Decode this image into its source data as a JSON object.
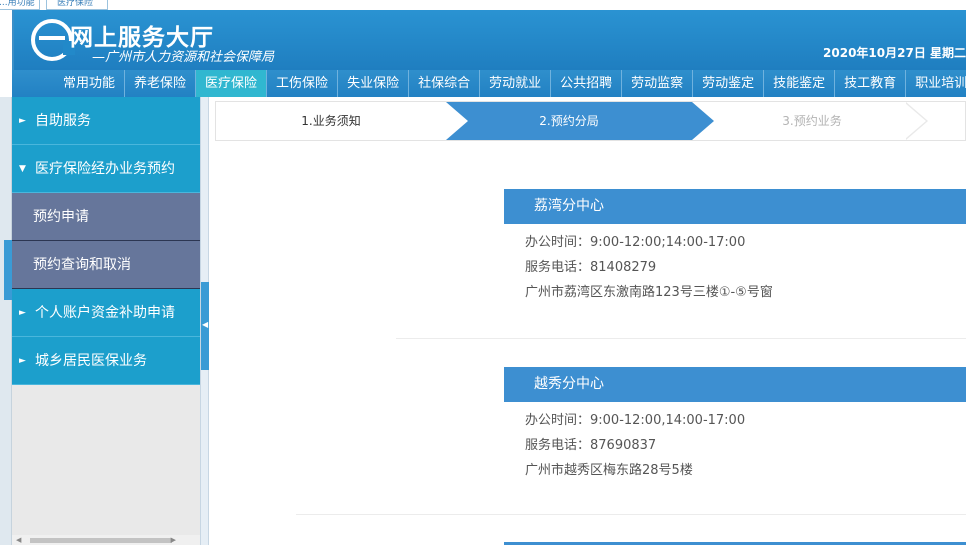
{
  "stub_tabs": [
    "...用功能",
    "医疗保险"
  ],
  "header": {
    "title": "网上服务大厅",
    "subtitle": "—广州市人力资源和社会保障局",
    "date": "2020年10月27日 星期二"
  },
  "nav": {
    "items": [
      "常用功能",
      "养老保险",
      "医疗保险",
      "工伤保险",
      "失业保险",
      "社保综合",
      "劳动就业",
      "公共招聘",
      "劳动监察",
      "劳动鉴定",
      "技能鉴定",
      "技工教育",
      "职业培训"
    ],
    "active": "医疗保险"
  },
  "sidebar": {
    "items": [
      {
        "label": "自助服务",
        "icon": "triangle-right-icon"
      },
      {
        "label": "医疗保险经办业务预约",
        "icon": "triangle-down-icon"
      },
      {
        "label": "预约申请"
      },
      {
        "label": "预约查询和取消"
      },
      {
        "label": "个人账户资金补助申请",
        "icon": "triangle-right-icon"
      },
      {
        "label": "城乡居民医保业务",
        "icon": "triangle-right-icon"
      }
    ]
  },
  "steps": [
    "1.业务须知",
    "2.预约分局",
    "3.预约业务"
  ],
  "offices": [
    {
      "name": "荔湾分中心",
      "hours": "办公时间：9:00-12:00;14:00-17:00",
      "phone": "服务电话：81408279",
      "address": "广州市荔湾区东激南路123号三楼①-⑤号窗"
    },
    {
      "name": "越秀分中心",
      "hours": "办公时间：9:00-12:00,14:00-17:00",
      "phone": "服务电话：87690837",
      "address": "广州市越秀区梅东路28号5楼"
    }
  ],
  "colors": {
    "header_blue": "#2289c9",
    "nav_active": "#30b7d0",
    "sidebar_item": "#1c9fcc",
    "sidebar_sub": "#66769b",
    "accent": "#3d8fd1"
  }
}
